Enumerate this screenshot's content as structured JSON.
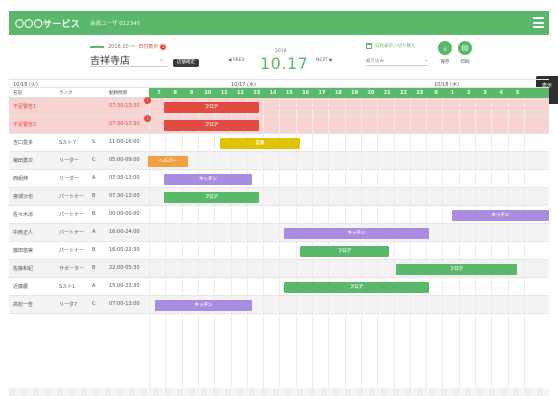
{
  "header": {
    "brand": "〇〇〇サービス",
    "user": "会員ユーザ 012345"
  },
  "toolbar": {
    "date_range": "2018.10 〜",
    "unconfirmed_link": "日付表示",
    "unconfirmed_count": "1",
    "store": "吉祥寺店",
    "unconfirmed_btn": "店舗確定",
    "prev": "◀ PREV",
    "next": "NEXT ▶",
    "year": "2018",
    "date": "10.17",
    "filter_link": "日程表示へ切り替え",
    "filter_select": "絞り込み",
    "save_label": "保存",
    "print_label": "印刷"
  },
  "days": {
    "d1": "10/16 (火)",
    "d2": "10/17 (水)",
    "d3": "10/18 (木)"
  },
  "columns": {
    "name": "名前",
    "rank": "ランク",
    "time": "勤務時間"
  },
  "hours": [
    "7",
    "8",
    "9",
    "10",
    "11",
    "12",
    "13",
    "14",
    "15",
    "16",
    "17",
    "18",
    "19",
    "20",
    "21",
    "22",
    "23",
    "0",
    "1",
    "2",
    "3",
    "4",
    "5"
  ],
  "rows": [
    {
      "name": "不足警告1",
      "rank": "",
      "grade": "",
      "time": "07:30-13:30"
    },
    {
      "name": "不足警告2",
      "rank": "",
      "grade": "",
      "time": "07:30-13:30"
    },
    {
      "name": "吉口愛多",
      "rank": "Sスト７",
      "grade": "S",
      "time": "11:00-16:00"
    },
    {
      "name": "菊田勇次",
      "rank": "リーダー",
      "grade": "C",
      "time": "05:00-09:00"
    },
    {
      "name": "西組伸",
      "rank": "リーダー",
      "grade": "A",
      "time": "07:30-13:00"
    },
    {
      "name": "宮城沙也",
      "rank": "パートナー",
      "grade": "B",
      "time": "07:30-13:00"
    },
    {
      "name": "佐々木凉",
      "rank": "パートナー",
      "grade": "B",
      "time": "00:00-00:00"
    },
    {
      "name": "中西正人",
      "rank": "パートナー",
      "grade": "A",
      "time": "16:00-24:00"
    },
    {
      "name": "藤田悠実",
      "rank": "パートナー",
      "grade": "B",
      "time": "16:00-22:30"
    },
    {
      "name": "佐藤和紀",
      "rank": "サポーター",
      "grade": "B",
      "time": "22:00-05:30"
    },
    {
      "name": "近藤慶",
      "rank": "Sスト1",
      "grade": "A",
      "time": "15:00-23:30"
    },
    {
      "name": "高松一告",
      "rank": "リーダ7",
      "grade": "C",
      "time": "07:00-13:00"
    }
  ],
  "shifts": [
    "フロア",
    "フロア",
    "店長",
    "ヘルパー",
    "キッチン",
    "フロア",
    "キッチン",
    "キッチン",
    "フロア",
    "フロア",
    "フロア",
    "キッチン"
  ],
  "side_tab": "表示",
  "colors": {
    "green": "#5ab86b",
    "red": "#e24a42",
    "yellow": "#e0c300",
    "orange": "#f0a040",
    "purple": "#a98be0"
  }
}
